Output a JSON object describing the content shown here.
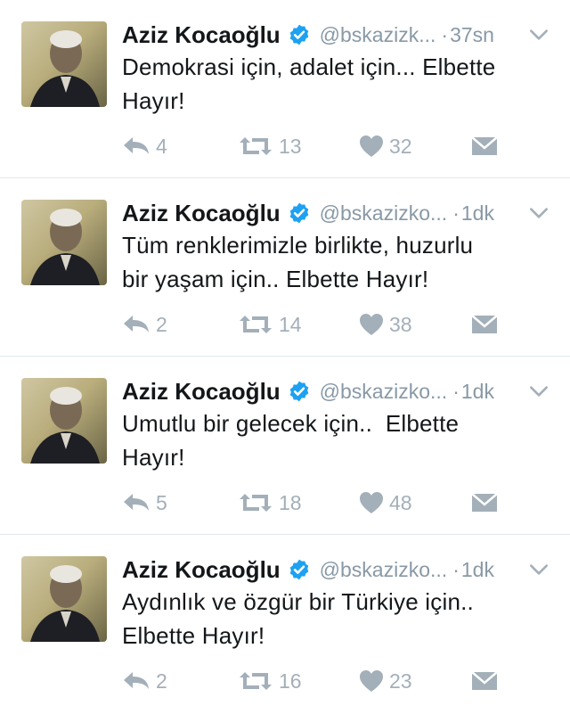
{
  "tweets": [
    {
      "name": "Aziz Kocaoğlu",
      "handle": "@bskazizk...",
      "time": "37sn",
      "text_lines": [
        "Demokrasi için, adalet için... Elbette",
        "Hayır!"
      ],
      "replies": "4",
      "retweets": "13",
      "likes": "32"
    },
    {
      "name": "Aziz Kocaoğlu",
      "handle": "@bskazizko...",
      "time": "1dk",
      "text_lines": [
        "Tüm renklerimizle birlikte, huzurlu",
        "bir yaşam için.. Elbette Hayır!"
      ],
      "replies": "2",
      "retweets": "14",
      "likes": "38"
    },
    {
      "name": "Aziz Kocaoğlu",
      "handle": "@bskazizko...",
      "time": "1dk",
      "text_lines": [
        "Umutlu bir gelecek için..  Elbette",
        "Hayır!"
      ],
      "replies": "5",
      "retweets": "18",
      "likes": "48"
    },
    {
      "name": "Aziz Kocaoğlu",
      "handle": "@bskazizko...",
      "time": "1dk",
      "text_lines": [
        "Aydınlık ve özgür bir Türkiye için..",
        "Elbette Hayır!"
      ],
      "replies": "2",
      "retweets": "16",
      "likes": "23"
    }
  ],
  "separator": "·",
  "icons": {
    "verified": "verified-badge-icon",
    "menu": "chevron-down-icon",
    "reply": "reply-icon",
    "retweet": "retweet-icon",
    "like": "heart-icon",
    "dm": "direct-message-icon"
  },
  "colors": {
    "verified": "#1da1f2",
    "icon_gray": "#a3afb9",
    "secondary_text": "#8899a6",
    "divider": "#e1e8ed"
  }
}
